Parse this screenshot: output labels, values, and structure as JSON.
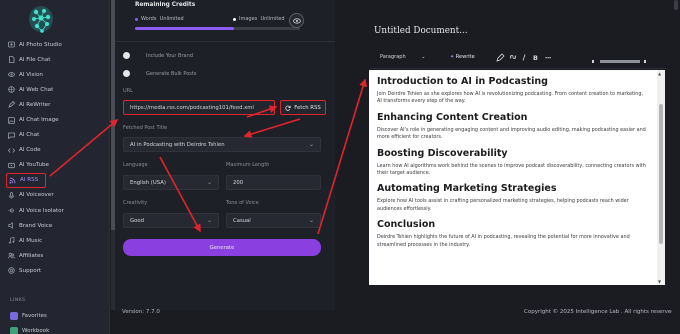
{
  "sidebar": {
    "items": [
      {
        "label": "AI Photo Studio",
        "icon": "photo-studio-icon"
      },
      {
        "label": "AI File Chat",
        "icon": "file-chat-icon"
      },
      {
        "label": "AI Vision",
        "icon": "vision-icon"
      },
      {
        "label": "AI Web Chat",
        "icon": "web-chat-icon"
      },
      {
        "label": "AI ReWriter",
        "icon": "rewriter-icon"
      },
      {
        "label": "AI Chat Image",
        "icon": "chat-image-icon"
      },
      {
        "label": "AI Chat",
        "icon": "chat-icon"
      },
      {
        "label": "AI Code",
        "icon": "code-icon"
      },
      {
        "label": "AI YouTube",
        "icon": "youtube-icon"
      },
      {
        "label": "AI RSS",
        "icon": "rss-icon",
        "active": true
      },
      {
        "label": "AI Voiceover",
        "icon": "voiceover-icon"
      },
      {
        "label": "AI Voice Isolator",
        "icon": "voice-isolator-icon"
      },
      {
        "label": "Brand Voice",
        "icon": "brand-voice-icon"
      },
      {
        "label": "AI Music",
        "icon": "music-icon"
      },
      {
        "label": "Affiliates",
        "icon": "affiliates-icon"
      },
      {
        "label": "Support",
        "icon": "support-icon"
      }
    ],
    "links_header": "LINKS",
    "links": [
      {
        "label": "Favorites",
        "icon": "favorites-icon"
      },
      {
        "label": "Workbook",
        "icon": "workbook-icon"
      }
    ]
  },
  "credits": {
    "title": "Remaining Credits",
    "words_label": "Words",
    "words_value": "Unlimited",
    "images_label": "Images",
    "images_value": "Unlimited",
    "words_color": "#8b5cf6",
    "images_color": "#ffffff",
    "fill_fraction": 0.6
  },
  "form": {
    "include_brand_label": "Include Your Brand",
    "bulk_posts_label": "Generate Bulk Posts",
    "url_label": "URL",
    "url_value": "https://media.rss.com/podcasting101/feed.xml",
    "fetch_label": "Fetch RSS",
    "fetched_title_label": "Fetched Post Title",
    "fetched_title_value": "AI in Podcasting with Deirdre Tshien",
    "language_label": "Language",
    "language_value": "English (USA)",
    "max_length_label": "Maximum Length",
    "max_length_value": "200",
    "creativity_label": "Creativity",
    "creativity_value": "Good",
    "tone_label": "Tone of Voice",
    "tone_value": "Casual",
    "generate_label": "Generate"
  },
  "footer": {
    "version": "Version: 7.7.0",
    "copyright": "Copyright © 2025 Intelligence Lab . All rights reserved."
  },
  "editor": {
    "doc_title": "Untitled Document...",
    "toolbar": {
      "paragraph": "Paragraph",
      "rewrite": "Rewrite"
    },
    "sections": [
      {
        "heading": "Introduction to AI in Podcasting",
        "body": "Join Deirdre Tshien as she explores how AI is revolutionizing podcasting. From content creation to marketing, AI transforms every step of the way."
      },
      {
        "heading": "Enhancing Content Creation",
        "body": "Discover AI's role in generating engaging content and improving audio editing, making podcasting easier and more efficient for creators."
      },
      {
        "heading": "Boosting Discoverability",
        "body": "Learn how AI algorithms work behind the scenes to improve podcast discoverability, connecting creators with their target audience."
      },
      {
        "heading": "Automating Marketing Strategies",
        "body": "Explore how AI tools assist in crafting personalized marketing strategies, helping podcasts reach wider audiences effortlessly."
      },
      {
        "heading": "Conclusion",
        "body": "Deirdre Tshien highlights the future of AI in podcasting, revealing the potential for more innovative and streamlined processes in the industry."
      }
    ]
  },
  "colors": {
    "accent": "#8a3fe0",
    "highlight": "#e0242b"
  }
}
